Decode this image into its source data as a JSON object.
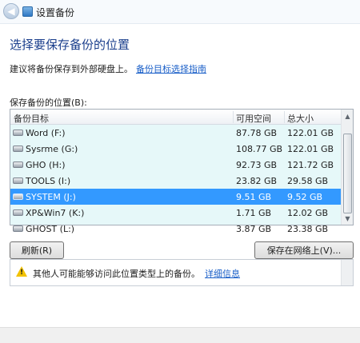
{
  "window": {
    "title": "设置备份"
  },
  "heading": "选择要保存备份的位置",
  "hint": {
    "text": "建议将备份保存到外部硬盘上。",
    "link": "备份目标选择指南"
  },
  "list_label": "保存备份的位置(B):",
  "columns": {
    "target": "备份目标",
    "free": "可用空间",
    "total": "总大小"
  },
  "drives": [
    {
      "name": "Word (F:)",
      "free": "87.78 GB",
      "total": "122.01 GB",
      "selected": false
    },
    {
      "name": "Sysrme (G:)",
      "free": "108.77 GB",
      "total": "122.01 GB",
      "selected": false
    },
    {
      "name": "GHO (H:)",
      "free": "92.73 GB",
      "total": "121.72 GB",
      "selected": false
    },
    {
      "name": "TOOLS (I:)",
      "free": "23.82 GB",
      "total": "29.58 GB",
      "selected": false
    },
    {
      "name": "SYSTEM (J:)",
      "free": "9.51 GB",
      "total": "9.52 GB",
      "selected": true
    },
    {
      "name": "XP&Win7 (K:)",
      "free": "1.71 GB",
      "total": "12.02 GB",
      "selected": false
    },
    {
      "name": "GHOST (L:)",
      "free": "3.87 GB",
      "total": "23.38 GB",
      "selected": false
    }
  ],
  "buttons": {
    "refresh": "刷新(R)",
    "network": "保存在网络上(V)..."
  },
  "warning": {
    "text": "其他人可能能够访问此位置类型上的备份。",
    "link": "详细信息"
  }
}
